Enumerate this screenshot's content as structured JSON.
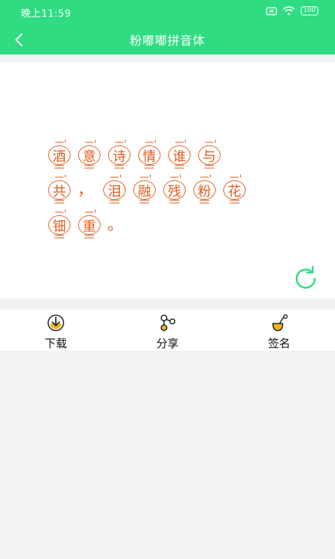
{
  "status_bar": {
    "time": "晚上11:59",
    "battery": "100"
  },
  "header": {
    "title": "粉嘟嘟拼音体"
  },
  "preview": {
    "lines": [
      [
        "酒",
        "意",
        "诗",
        "情",
        "谁",
        "与"
      ],
      [
        "共",
        "，",
        "泪",
        "融",
        "残",
        "粉",
        "花"
      ],
      [
        "钿",
        "重",
        "。"
      ]
    ]
  },
  "toolbar": {
    "download_label": "下载",
    "share_label": "分享",
    "sign_label": "签名"
  },
  "colors": {
    "accent": "#2fdc82",
    "glyph": "#e35a1b",
    "icon_yellow": "#f2b51a"
  }
}
